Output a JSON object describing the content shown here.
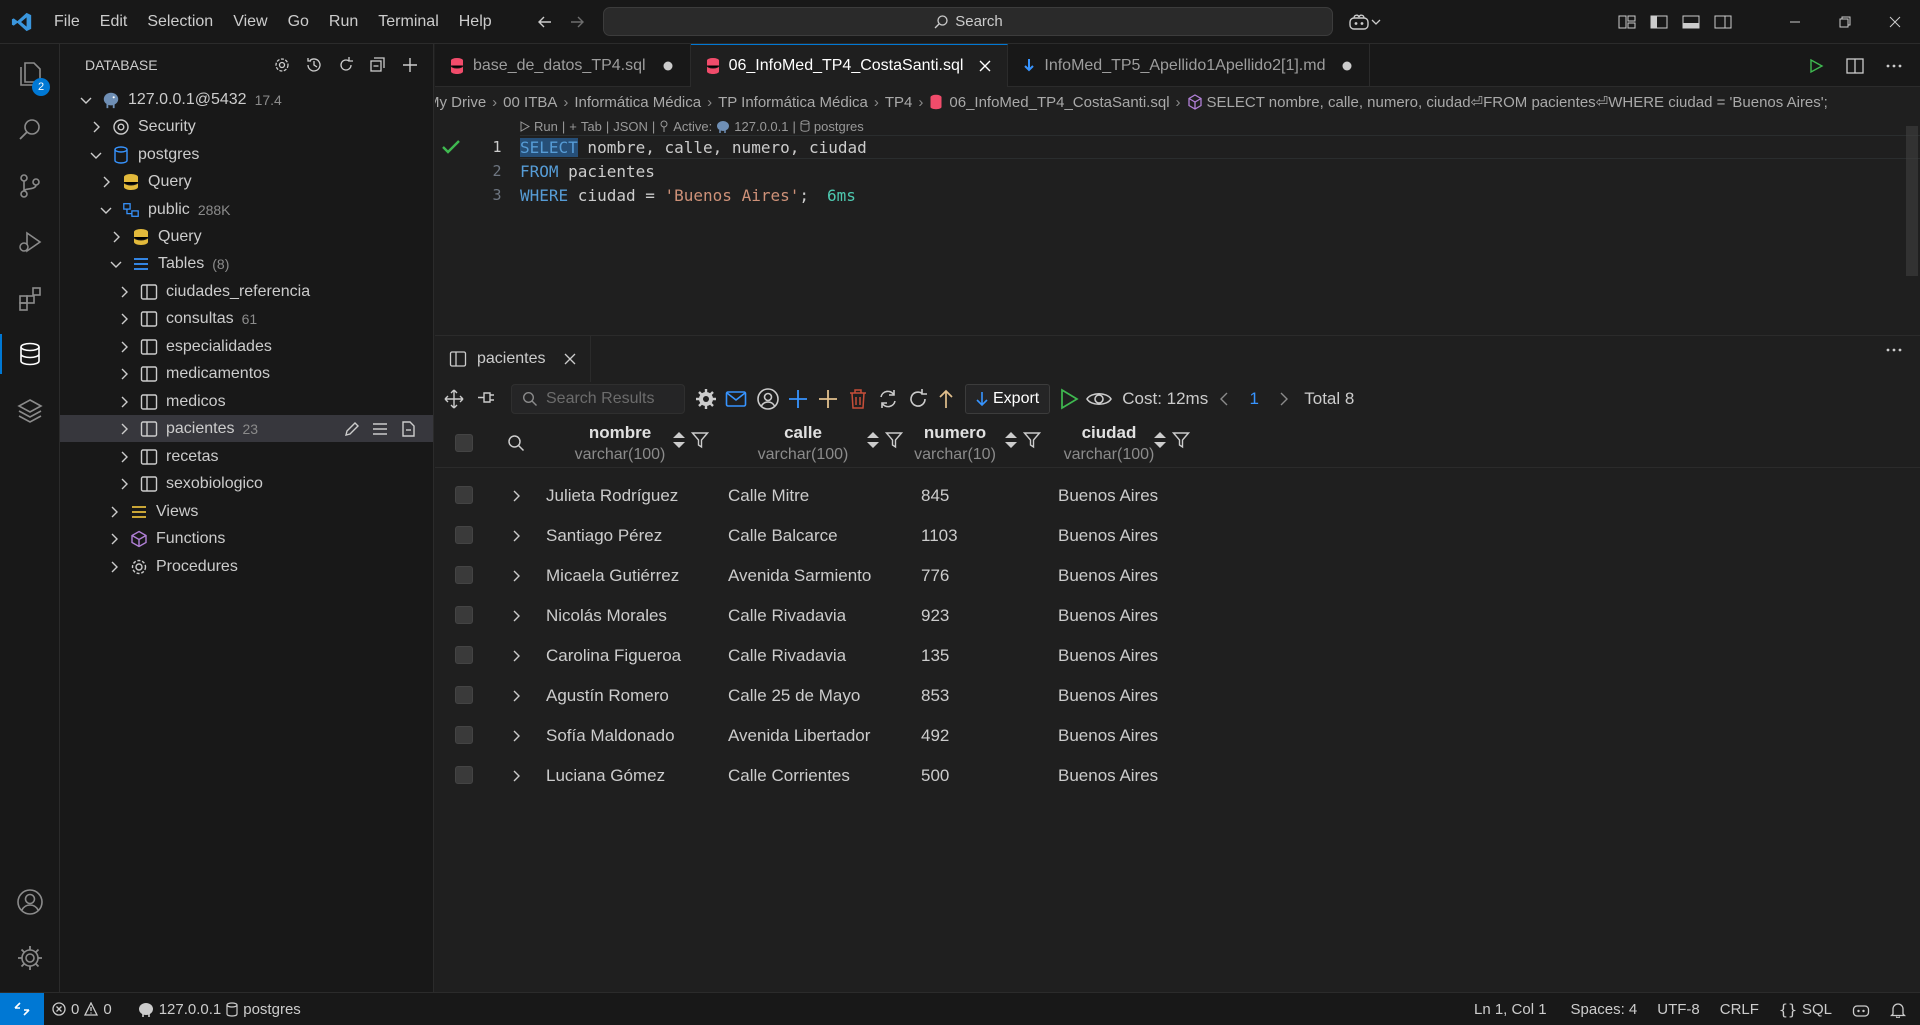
{
  "colors": {
    "accent": "#0078d4",
    "keyword": "#569cd6",
    "string": "#ce9178",
    "timing": "#4ec9b0",
    "success": "#3fb950",
    "sql_icon": "#f14c6b",
    "db_yellow": "#e2c08d"
  },
  "titlebar": {
    "menu": [
      "File",
      "Edit",
      "Selection",
      "View",
      "Go",
      "Run",
      "Terminal",
      "Help"
    ],
    "search_label": "Search"
  },
  "activitybar": {
    "explorer_badge": "2"
  },
  "sidebar": {
    "title": "DATABASE",
    "tree": [
      {
        "label": "127.0.0.1@5432",
        "meta": "17.4",
        "icon": "postgres-elephant-icon"
      },
      {
        "label": "Security",
        "meta": "",
        "icon": "security-icon"
      },
      {
        "label": "postgres",
        "meta": "",
        "icon": "database-icon"
      },
      {
        "label": "Query",
        "meta": "",
        "icon": "query-icon"
      },
      {
        "label": "public",
        "meta": "288K",
        "icon": "schema-icon"
      },
      {
        "label": "Query",
        "meta": "",
        "icon": "query-icon"
      },
      {
        "label": "Tables",
        "meta": "(8)",
        "icon": "tables-icon"
      },
      {
        "label": "ciudades_referencia",
        "meta": "",
        "icon": "table-icon"
      },
      {
        "label": "consultas",
        "meta": "61",
        "icon": "table-icon"
      },
      {
        "label": "especialidades",
        "meta": "",
        "icon": "table-icon"
      },
      {
        "label": "medicamentos",
        "meta": "",
        "icon": "table-icon"
      },
      {
        "label": "medicos",
        "meta": "",
        "icon": "table-icon"
      },
      {
        "label": "pacientes",
        "meta": "23",
        "icon": "table-icon"
      },
      {
        "label": "recetas",
        "meta": "",
        "icon": "table-icon"
      },
      {
        "label": "sexobiologico",
        "meta": "",
        "icon": "table-icon"
      },
      {
        "label": "Views",
        "meta": "",
        "icon": "views-icon"
      },
      {
        "label": "Functions",
        "meta": "",
        "icon": "functions-icon"
      },
      {
        "label": "Procedures",
        "meta": "",
        "icon": "procedures-icon"
      }
    ]
  },
  "tabs": [
    {
      "label": "base_de_datos_TP4.sql",
      "icon": "sql-file-icon",
      "state": "modified"
    },
    {
      "label": "06_InfoMed_TP4_CostaSanti.sql",
      "icon": "sql-file-icon",
      "state": "active"
    },
    {
      "label": "InfoMed_TP5_Apellido1Apellido2[1].md",
      "icon": "markdown-file-icon",
      "state": "modified"
    }
  ],
  "breadcrumb": {
    "items": [
      "My Drive",
      "00 ITBA",
      "Informática Médica",
      "TP Informática Médica",
      "TP4",
      "06_InfoMed_TP4_CostaSanti.sql"
    ],
    "symbol": "SELECT nombre, calle, numero, ciudad⏎FROM pacientes⏎WHERE ciudad = 'Buenos Aires';"
  },
  "codelens": {
    "run": "Run",
    "tab": "Tab",
    "json": "JSON",
    "active": "Active:",
    "host": "127.0.0.1",
    "db": "postgres"
  },
  "editor": {
    "lines": [
      {
        "number": "1",
        "parts": [
          {
            "t": "kw",
            "v": "SELECT"
          },
          {
            "t": "id",
            "v": " nombre, calle, numero, ciudad"
          }
        ]
      },
      {
        "number": "2",
        "parts": [
          {
            "t": "kw",
            "v": "FROM"
          },
          {
            "t": "id",
            "v": " pacientes"
          }
        ]
      },
      {
        "number": "3",
        "parts": [
          {
            "t": "kw",
            "v": "WHERE"
          },
          {
            "t": "id",
            "v": " ciudad = "
          },
          {
            "t": "str",
            "v": "'Buenos Aires'"
          },
          {
            "t": "id",
            "v": ";"
          }
        ]
      }
    ],
    "timing": "6ms"
  },
  "panel": {
    "tab_label": "pacientes",
    "search_placeholder": "Search Results",
    "export_label": "Export",
    "cost_label": "Cost: 12ms",
    "page": "1",
    "total_label": "Total 8",
    "columns": [
      {
        "name": "nombre",
        "type": "varchar(100)"
      },
      {
        "name": "calle",
        "type": "varchar(100)"
      },
      {
        "name": "numero",
        "type": "varchar(10)"
      },
      {
        "name": "ciudad",
        "type": "varchar(100)"
      }
    ],
    "rows": [
      [
        "Julieta Rodríguez",
        "Calle Mitre",
        "845",
        "Buenos Aires"
      ],
      [
        "Santiago Pérez",
        "Calle Balcarce",
        "1103",
        "Buenos Aires"
      ],
      [
        "Micaela Gutiérrez",
        "Avenida Sarmiento",
        "776",
        "Buenos Aires"
      ],
      [
        "Nicolás Morales",
        "Calle Rivadavia",
        "923",
        "Buenos Aires"
      ],
      [
        "Carolina Figueroa",
        "Calle Rivadavia",
        "135",
        "Buenos Aires"
      ],
      [
        "Agustín Romero",
        "Calle 25 de Mayo",
        "853",
        "Buenos Aires"
      ],
      [
        "Sofía Maldonado",
        "Avenida Libertador",
        "492",
        "Buenos Aires"
      ],
      [
        "Luciana Gómez",
        "Calle Corrientes",
        "500",
        "Buenos Aires"
      ]
    ]
  },
  "statusbar": {
    "errors": "0",
    "warnings": "0",
    "host": "127.0.0.1",
    "db": "postgres",
    "position": "Ln 1, Col 1",
    "spaces": "Spaces: 4",
    "encoding": "UTF-8",
    "eol": "CRLF",
    "language": "SQL"
  }
}
